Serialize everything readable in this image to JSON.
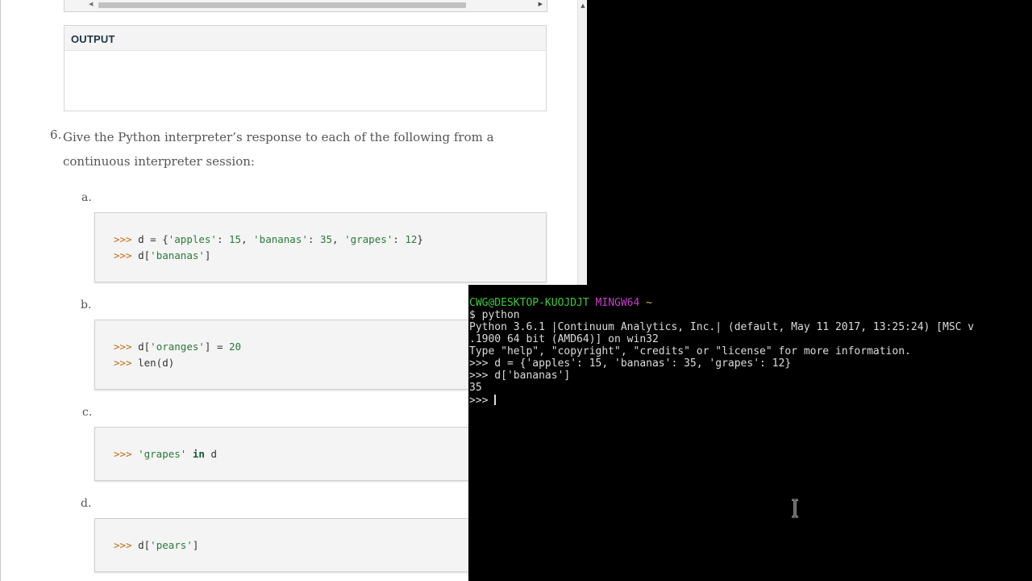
{
  "page": {
    "output_label": "OUTPUT",
    "question": {
      "number": "6.",
      "text": "Give the Python interpreter’s response to each of the following from a continuous interpreter session:"
    },
    "parts": [
      {
        "label": "a.",
        "lines": [
          {
            "prompt": ">>>",
            "code": "d = {'apples': 15, 'bananas': 35, 'grapes': 12}"
          },
          {
            "prompt": ">>>",
            "code": "d['bananas']"
          }
        ]
      },
      {
        "label": "b.",
        "lines": [
          {
            "prompt": ">>>",
            "code": "d['oranges'] = 20"
          },
          {
            "prompt": ">>>",
            "code": "len(d)"
          }
        ]
      },
      {
        "label": "c.",
        "lines": [
          {
            "prompt": ">>>",
            "code": "'grapes' in d"
          }
        ]
      },
      {
        "label": "d.",
        "lines": [
          {
            "prompt": ">>>",
            "code": "d['pears']"
          }
        ]
      }
    ]
  },
  "terminal": {
    "user_host": "CWG@DESKTOP-KUOJDJT",
    "shell": "MINGW64",
    "cwd": "~",
    "lines": [
      "$ python",
      "Python 3.6.1 |Continuum Analytics, Inc.| (default, May 11 2017, 13:25:24) [MSC v",
      ".1900 64 bit (AMD64)] on win32",
      "Type \"help\", \"copyright\", \"credits\" or \"license\" for more information.",
      ">>> d = {'apples': 15, 'bananas': 35, 'grapes': 12}",
      ">>> d['bananas']",
      "35",
      ">>> "
    ]
  },
  "colors": {
    "prompt": "#c06a1a",
    "string": "#2a7a3a",
    "terminal_user": "#3ccc3c",
    "terminal_shell": "#c83ccc",
    "terminal_cwd": "#d0c040"
  }
}
